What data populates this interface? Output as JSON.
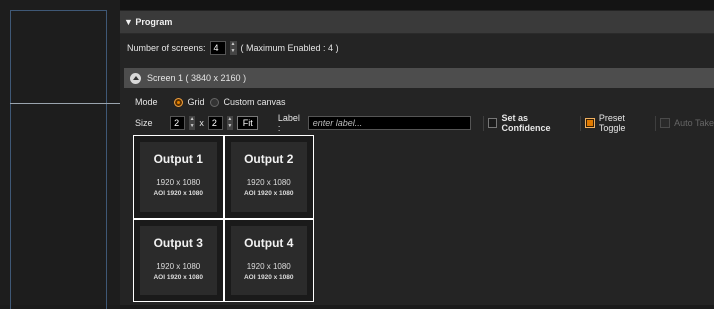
{
  "program": {
    "title": "▼ Program"
  },
  "screens": {
    "label": "Number of screens:",
    "value": "4",
    "max_text": "( Maximum Enabled : 4 )"
  },
  "screen1": {
    "title": "Screen 1  ( 3840 x 2160 )",
    "mode_label": "Mode",
    "mode_options": [
      "Grid",
      "Custom canvas"
    ],
    "mode_selected": "Grid",
    "size_label": "Size",
    "size_cols": "2",
    "size_x": "x",
    "size_rows": "2",
    "fit_label": "Fit",
    "label_label": "Label :",
    "label_placeholder": "enter label...",
    "set_confidence_label": "Set as Confidence",
    "set_confidence_checked": false,
    "preset_toggle_label": "Preset Toggle",
    "preset_toggle_checked": true,
    "auto_take_label": "Auto Take",
    "auto_take_enabled": false
  },
  "outputs": [
    {
      "name": "Output 1",
      "resolution": "1920 x 1080",
      "aoi": "AOI 1920 x 1080"
    },
    {
      "name": "Output 2",
      "resolution": "1920 x 1080",
      "aoi": "AOI 1920 x 1080"
    },
    {
      "name": "Output 3",
      "resolution": "1920 x 1080",
      "aoi": "AOI 1920 x 1080"
    },
    {
      "name": "Output 4",
      "resolution": "1920 x 1080",
      "aoi": "AOI 1920 x 1080"
    }
  ],
  "colors": {
    "accent": "#e38200",
    "panel": "#242424",
    "header": "#3a3a3a",
    "screen_header": "#4d4d4d",
    "divider": "#3f5876"
  }
}
